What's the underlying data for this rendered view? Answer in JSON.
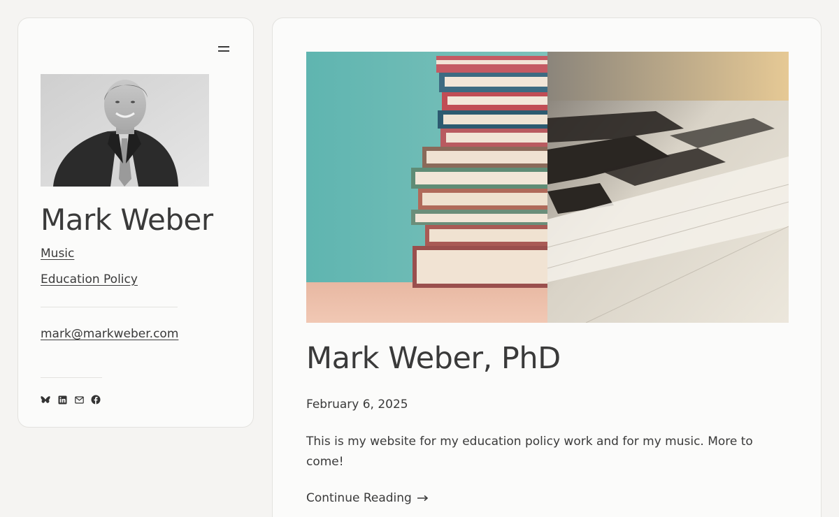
{
  "sidebar": {
    "menu_icon": "hamburger-icon",
    "site_title": "Mark Weber",
    "nav": [
      {
        "label": "Music"
      },
      {
        "label": "Education Policy"
      }
    ],
    "email": "mark@markweber.com",
    "social_icons": [
      "bluesky-icon",
      "linkedin-icon",
      "mail-icon",
      "facebook-icon"
    ]
  },
  "post": {
    "title": "Mark Weber, PhD",
    "date": "February 6, 2025",
    "excerpt": "This is my website for my education policy work and for my music. More to come!",
    "continue_label": "Continue Reading",
    "continue_icon": "arrow-right-icon"
  },
  "colors": {
    "background": "#f5f4f2",
    "card": "#fbfbfa",
    "text": "#3a3a3a",
    "border": "#e3e2df"
  }
}
